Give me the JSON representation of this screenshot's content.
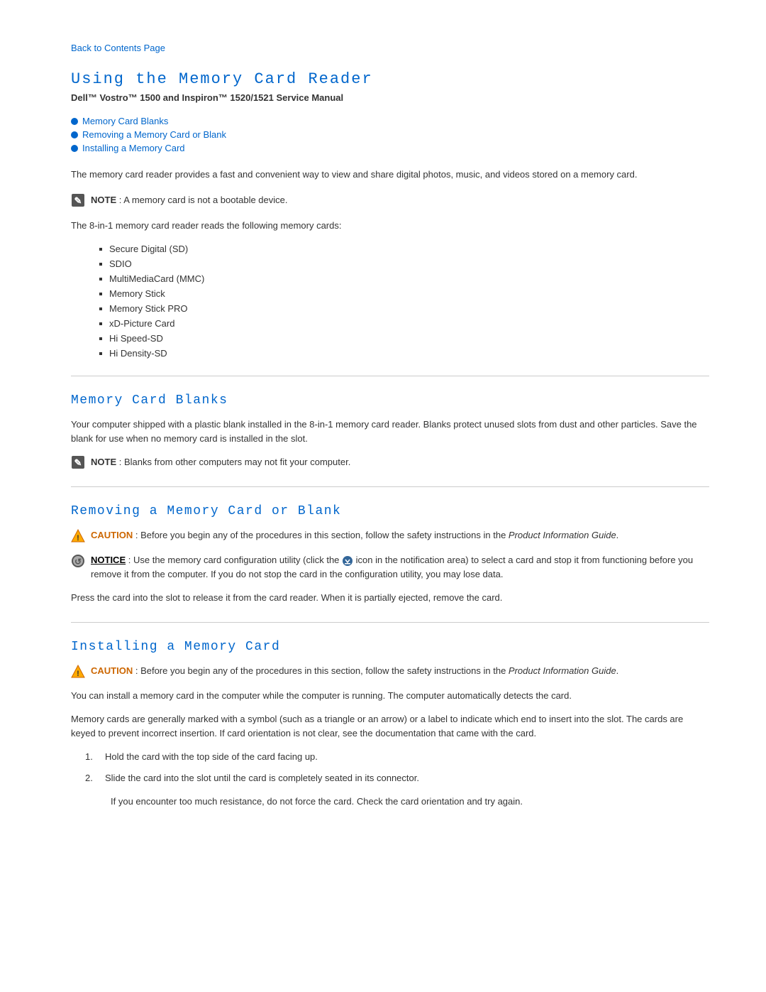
{
  "back_link": {
    "label": "Back to Contents Page",
    "href": "#"
  },
  "page_title": "Using the Memory Card Reader",
  "subtitle": "Dell™ Vostro™ 1500 and Inspiron™ 1520/1521 Service Manual",
  "toc": {
    "items": [
      {
        "label": "Memory Card Blanks",
        "href": "#memory-card-blanks"
      },
      {
        "label": "Removing a Memory Card or Blank",
        "href": "#removing"
      },
      {
        "label": "Installing a Memory Card",
        "href": "#installing"
      }
    ]
  },
  "intro": {
    "text": "The memory card reader provides a fast and convenient way to view and share digital photos, music, and videos stored on a memory card."
  },
  "note1": {
    "label": "NOTE",
    "text": "A memory card is not a bootable device."
  },
  "card_list_intro": "The 8-in-1 memory card reader reads the following memory cards:",
  "card_list": [
    "Secure Digital (SD)",
    "SDIO",
    "MultiMediaCard (MMC)",
    "Memory Stick",
    "Memory Stick PRO",
    "xD-Picture Card",
    "Hi Speed-SD",
    "Hi Density-SD"
  ],
  "section_blanks": {
    "title": "Memory Card Blanks",
    "text": "Your computer shipped with a plastic blank installed in the 8-in-1 memory card reader. Blanks protect unused slots from dust and other particles. Save the blank for use when no memory card is installed in the slot.",
    "note": {
      "label": "NOTE",
      "text": "Blanks from other computers may not fit your computer."
    }
  },
  "section_removing": {
    "title": "Removing a Memory Card or Blank",
    "caution": {
      "label": "CAUTION",
      "text": "Before you begin any of the procedures in this section, follow the safety instructions in the",
      "guide": "Product Information Guide",
      "suffix": "."
    },
    "notice": {
      "label": "NOTICE",
      "text_before": "Use the memory card configuration utility (click the",
      "icon_alt": "tray-icon",
      "text_after": "icon in the notification area) to select a card and stop it from functioning before you remove it from the computer. If you do not stop the card in the configuration utility, you may lose data."
    },
    "text": "Press the card into the slot to release it from the card reader. When it is partially ejected, remove the card."
  },
  "section_installing": {
    "title": "Installing a Memory Card",
    "caution": {
      "label": "CAUTION",
      "text": "Before you begin any of the procedures in this section, follow the safety instructions in the",
      "guide": "Product Information Guide",
      "suffix": "."
    },
    "intro_text": "You can install a memory card in the computer while the computer is running. The computer automatically detects the card.",
    "detail_text": "Memory cards are generally marked with a symbol (such as a triangle or an arrow) or a label to indicate which end to insert into the slot. The cards are keyed to prevent incorrect insertion. If card orientation is not clear, see the documentation that came with the card.",
    "steps": [
      {
        "num": "1.",
        "text": "Hold the card with the top side of the card facing up."
      },
      {
        "num": "2.",
        "text": "Slide the card into the slot until the card is completely seated in its connector."
      }
    ],
    "sub_note": "If you encounter too much resistance, do not force the card. Check the card orientation and try again."
  }
}
